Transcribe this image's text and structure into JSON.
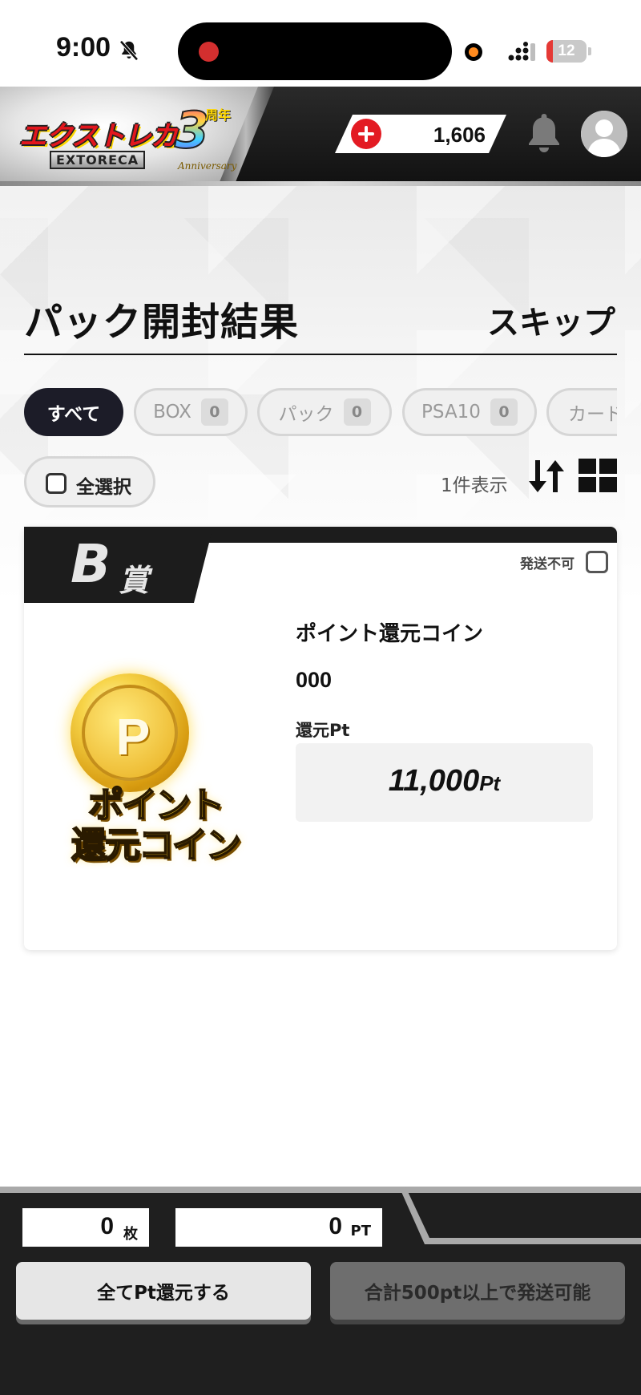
{
  "status_bar": {
    "time": "9:00",
    "battery": "12",
    "icons": [
      "bell-off-icon",
      "signal-icon",
      "battery-icon"
    ]
  },
  "header": {
    "logo_text": "エクストレカ",
    "logo_sub": "EXTORECA",
    "anniversary_number": "3",
    "anniversary_word": "周年",
    "anniversary_en": "Anniversary",
    "points": "1,606",
    "icons": [
      "plus-icon",
      "bell-icon",
      "user-avatar-icon"
    ]
  },
  "page": {
    "title": "パック開封結果",
    "skip_label": "スキップ"
  },
  "filters": [
    {
      "label": "すべて",
      "count": null,
      "active": true
    },
    {
      "label": "BOX",
      "count": "0",
      "active": false
    },
    {
      "label": "パック",
      "count": "0",
      "active": false
    },
    {
      "label": "PSA10",
      "count": "0",
      "active": false
    },
    {
      "label": "カード",
      "count": null,
      "active": false
    }
  ],
  "toolbar": {
    "select_all_label": "全選択",
    "count_label": "1件表示",
    "icons": [
      "sort-icon",
      "grid-view-icon"
    ]
  },
  "card": {
    "rank_letter": "B",
    "rank_suffix": "賞",
    "unshippable_label": "発送不可",
    "image_text_line1": "ポイント",
    "image_text_line2": "還元コイン",
    "coin_letter": "P",
    "item_name": "ポイント還元コイン",
    "item_code": "000",
    "refund_label": "還元Pt",
    "refund_value": "11,000",
    "refund_unit": "Pt"
  },
  "bottom": {
    "count_value": "0",
    "count_unit": "枚",
    "pt_value": "0",
    "pt_unit": "PT",
    "refund_all_label": "全てPt還元する",
    "ship_label": "合計500pt以上で発送可能"
  },
  "colors": {
    "accent_red": "#e31b23",
    "dark": "#1c1c28",
    "gold": "#f7d449"
  }
}
